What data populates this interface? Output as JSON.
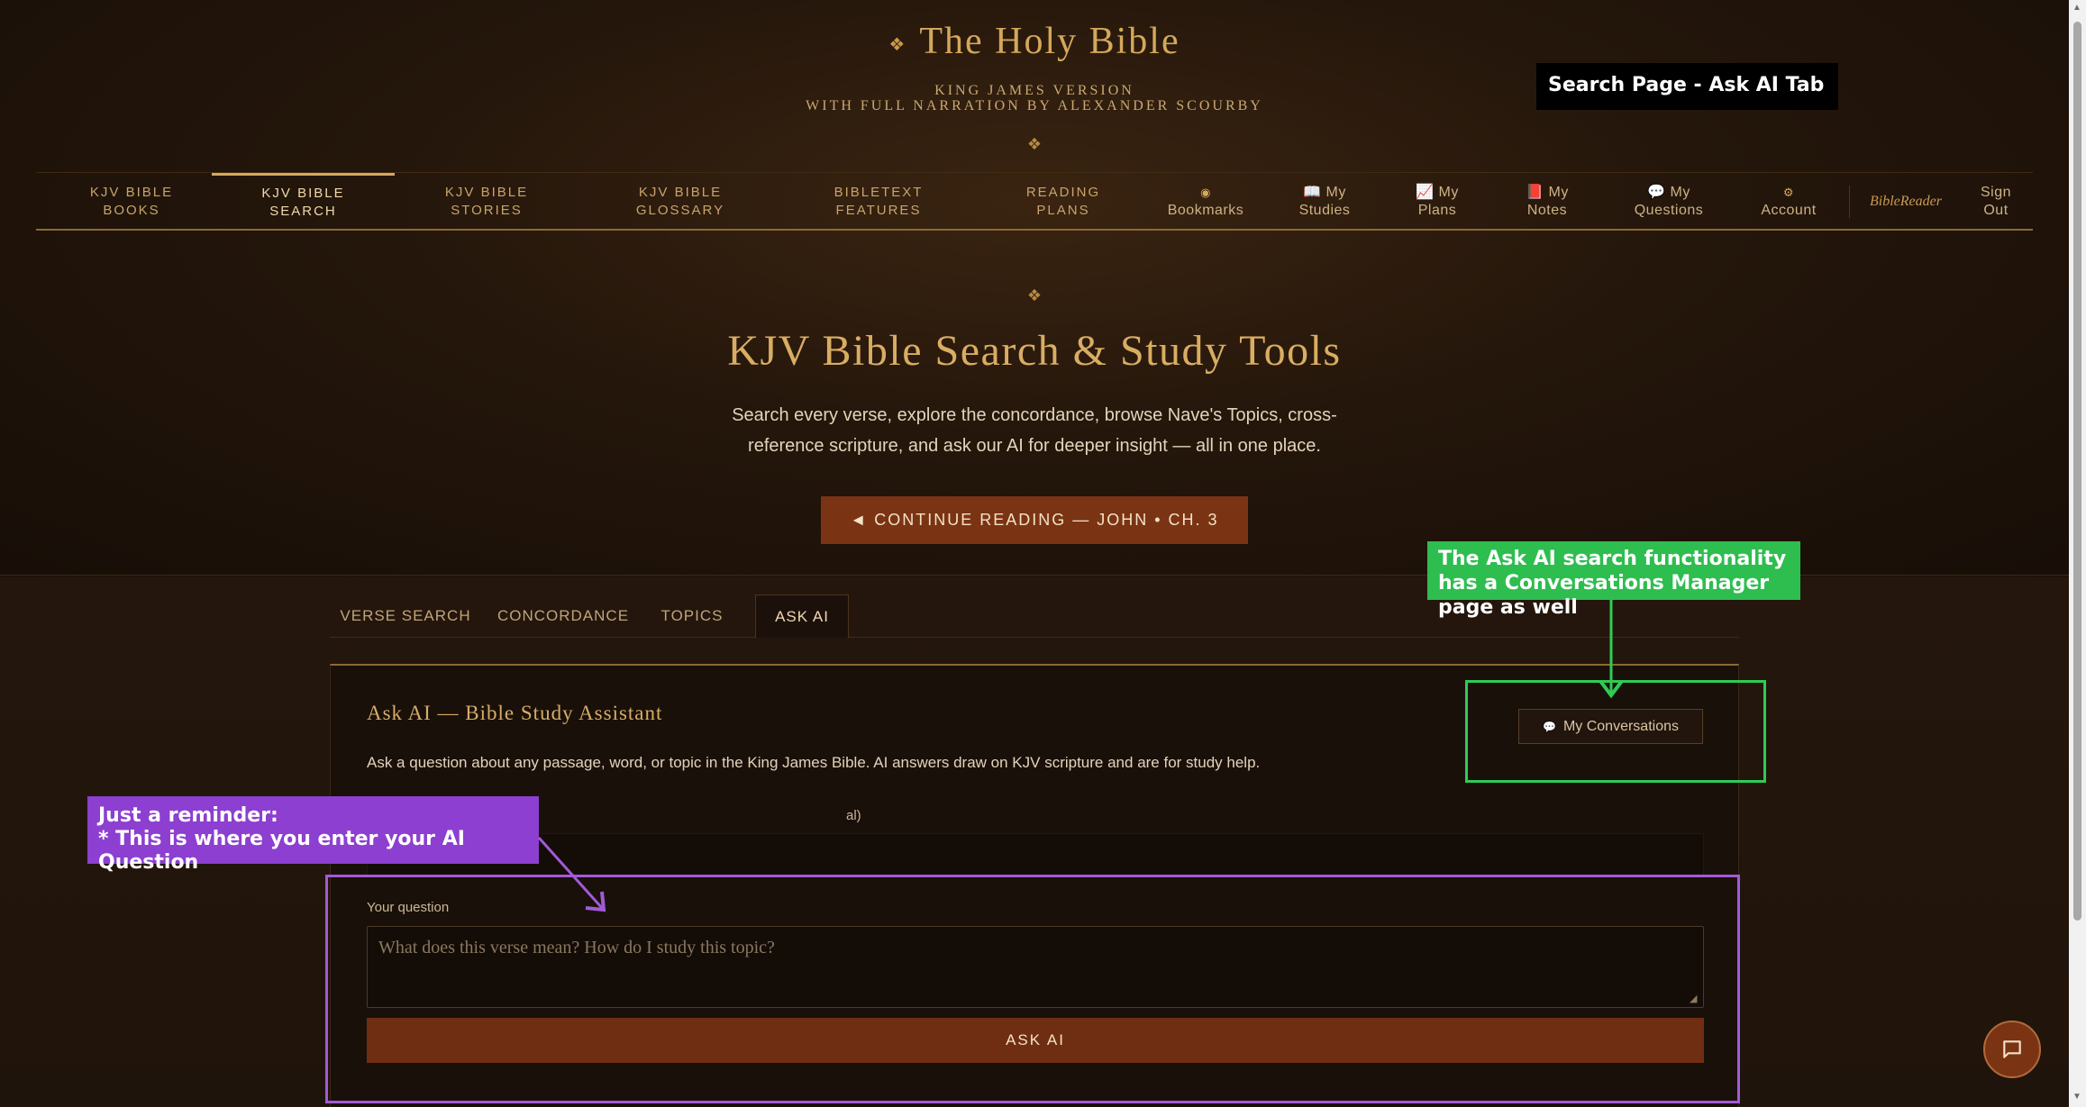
{
  "header": {
    "title": "The Holy Bible",
    "title_ornament": "❖",
    "subtitle_line1": "KING JAMES VERSION",
    "subtitle_line2": "WITH FULL NARRATION BY ALEXANDER SCOURBY",
    "ornament": "❖"
  },
  "nav": {
    "items": [
      {
        "line1": "KJV BIBLE",
        "line2": "BOOKS"
      },
      {
        "line1": "KJV BIBLE",
        "line2": "SEARCH"
      },
      {
        "line1": "KJV BIBLE",
        "line2": "STORIES"
      },
      {
        "line1": "KJV BIBLE",
        "line2": "GLOSSARY"
      },
      {
        "line1": "BIBLETEXT",
        "line2": "FEATURES"
      },
      {
        "line1": "READING",
        "line2": "PLANS"
      },
      {
        "line1": "◉",
        "line2": "Bookmarks"
      },
      {
        "line1": "📖 My",
        "line2": "Studies"
      },
      {
        "line1": "📈 My",
        "line2": "Plans"
      },
      {
        "line1": "📕 My",
        "line2": "Notes"
      },
      {
        "line1": "💬 My",
        "line2": "Questions"
      },
      {
        "line1": "⚙",
        "line2": "Account"
      }
    ],
    "brand": "BibleReader",
    "sign_out_line1": "Sign",
    "sign_out_line2": "Out"
  },
  "hero": {
    "ornament": "❖",
    "title": "KJV Bible Search & Study Tools",
    "text": "Search every verse, explore the concordance, browse Nave's Topics, cross-reference scripture, and ask our AI for deeper insight — all in one place.",
    "continue_button": "◄ CONTINUE READING — JOHN • CH. 3"
  },
  "tabs": [
    {
      "label": "VERSE SEARCH"
    },
    {
      "label": "CONCORDANCE"
    },
    {
      "label": "TOPICS"
    },
    {
      "label": "ASK AI"
    }
  ],
  "panel": {
    "title": "Ask AI — Bible Study Assistant",
    "description": "Ask a question about any passage, word, or topic in the King James Bible. AI answers draw on KJV scripture and are for study help.",
    "conversations_button": "My Conversations",
    "optional_label_visible": "al)",
    "question_label": "Your question",
    "question_placeholder": "What does this verse mean? How do I study this topic?",
    "ask_button": "ASK AI"
  },
  "annotations": {
    "black": "Search Page - Ask AI Tab",
    "green": "The Ask AI search functionality has a Conversations Manager page as well",
    "purple_line1": "Just a reminder:",
    "purple_line2": "* This is where you enter your AI Question",
    "colors": {
      "green": "#2ecc55",
      "purple": "#a25ad8",
      "black": "#000000"
    }
  },
  "colors": {
    "accent_gold": "#d4a85a",
    "button_rust": "#7a3414",
    "background": "#1d120a"
  }
}
